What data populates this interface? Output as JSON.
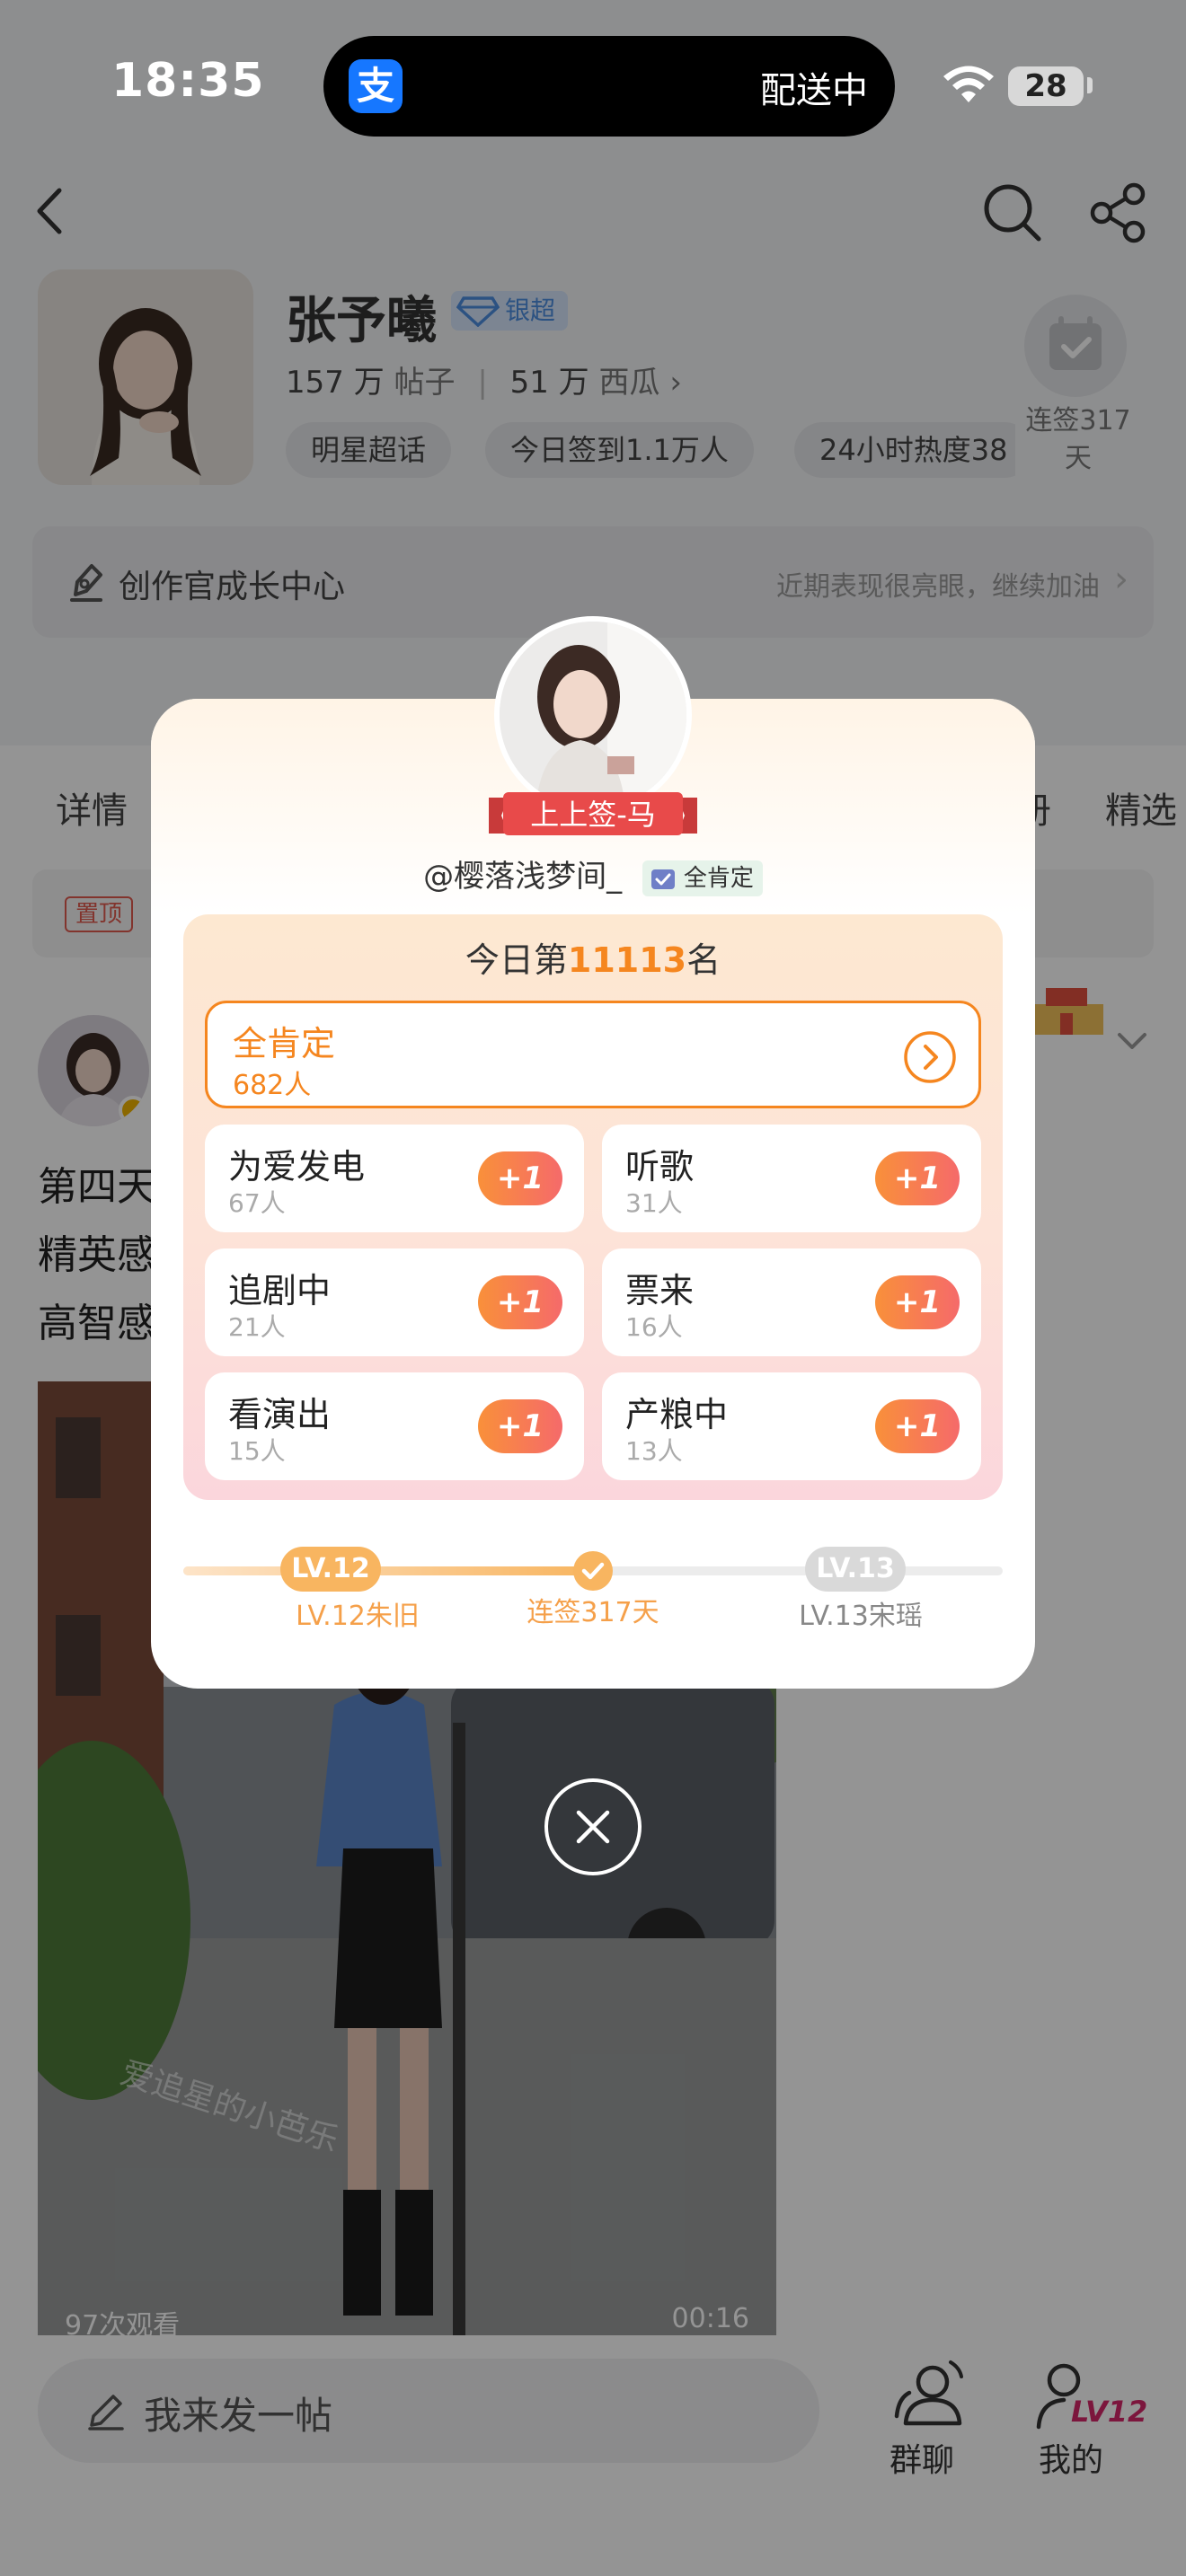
{
  "status_bar": {
    "time": "18:35",
    "island_app_glyph": "支",
    "island_text": "配送中",
    "battery": "28",
    "icons": [
      "wifi-icon",
      "battery-icon"
    ]
  },
  "header": {
    "star_name": "张予曦",
    "tier_badge": "银超",
    "posts_count": "157 万",
    "posts_label": "帖子",
    "fans_count": "51 万",
    "fans_label": "西瓜",
    "tags": [
      "明星超话",
      "今日签到1.1万人",
      "24小时热度38"
    ],
    "checkin_label": "连签317天",
    "growth_title": "创作官成长中心",
    "growth_right": "近期表现很亮眼，继续加油"
  },
  "content": {
    "tabs": [
      "详情",
      "册",
      "精选"
    ],
    "pin_badge": "置顶",
    "post_lines": [
      "第四天",
      "精英感",
      "高智感"
    ],
    "views": "97次观看",
    "duration": "00:16",
    "watermark": "爱追星的小芭乐"
  },
  "bottom_bar": {
    "compose_placeholder": "我来发一帖",
    "group_label": "群聊",
    "mine_label": "我的",
    "mine_badge": "LV12"
  },
  "popup": {
    "rank_tag": "上上签-马",
    "handle": "@樱落浅梦间_",
    "handle_badge": "全肯定",
    "rank_prefix": "今日第",
    "rank_number": "11113",
    "rank_suffix": "名",
    "highlight": {
      "title": "全肯定",
      "count": "682人"
    },
    "options": [
      {
        "title": "为爱发电",
        "count": "67人",
        "button": "+1"
      },
      {
        "title": "听歌",
        "count": "31人",
        "button": "+1"
      },
      {
        "title": "追剧中",
        "count": "21人",
        "button": "+1"
      },
      {
        "title": "票来",
        "count": "16人",
        "button": "+1"
      },
      {
        "title": "看演出",
        "count": "15人",
        "button": "+1"
      },
      {
        "title": "产粮中",
        "count": "13人",
        "button": "+1"
      }
    ],
    "level": {
      "current_pill": "LV.12",
      "next_pill": "LV.13",
      "current_label": "LV.12朱旧",
      "middle_label": "连签317天",
      "next_label": "LV.13宋瑶",
      "progress": 0.5
    }
  },
  "colors": {
    "accent_orange": "#f5861f",
    "plus_gradient_start": "#f9903a",
    "plus_gradient_end": "#f56a6a",
    "ribbon_red": "#e84a4a",
    "tier_blue": "#4d8ee0"
  }
}
